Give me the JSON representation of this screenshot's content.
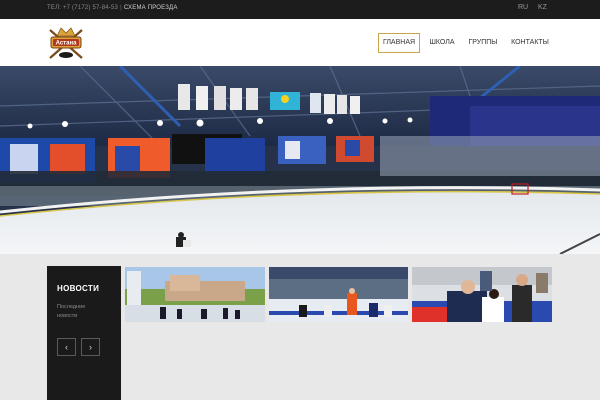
{
  "topbar": {
    "phone": "ТЕЛ: +7 (7172) 57-84-53",
    "separator": "|",
    "map_link": "СХЕМА ПРОЕЗДА",
    "lang_ru": "RU",
    "lang_kz": "KZ"
  },
  "header": {
    "logo_text": "Астана",
    "nav": [
      {
        "label": "ГЛАВНАЯ"
      },
      {
        "label": "ШКОЛА"
      },
      {
        "label": "ГРУППЫ"
      },
      {
        "label": "КОНТАКТЫ"
      }
    ],
    "accent_color": "#c8a64a"
  },
  "news": {
    "title": "НОВОСТИ",
    "subtitle": "Последние новости",
    "prev_icon": "‹",
    "next_icon": "›"
  }
}
